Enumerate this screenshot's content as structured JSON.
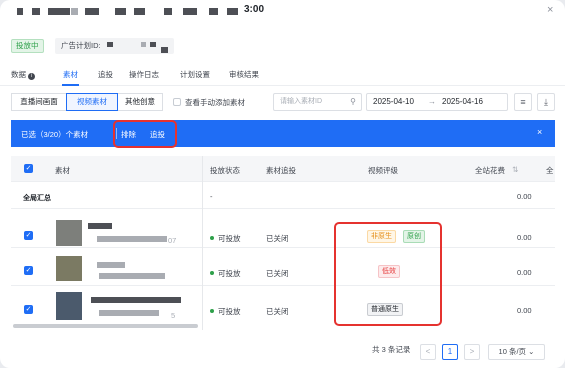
{
  "header": {
    "title": "3:00",
    "close_glyph": "×"
  },
  "status_badge": "投放中",
  "plan_label": "广告计划ID:",
  "tabs": [
    {
      "label": "数据"
    },
    {
      "label": "素材"
    },
    {
      "label": "追投"
    },
    {
      "label": "操作日志"
    },
    {
      "label": "计划设置"
    },
    {
      "label": "审核结果"
    }
  ],
  "toolbar": {
    "view_buttons": [
      "直播间画面",
      "视频素材",
      "其他创意"
    ],
    "manual_checkbox_label": "查看手动添加素材",
    "search_placeholder": "请输入素材ID",
    "date_start": "2025-04-10",
    "date_sep": "→",
    "date_end": "2025-04-16",
    "search_icon": "⚲",
    "settings_icon": "≡",
    "download_icon": "⤓"
  },
  "selection_bar": {
    "selected_text": "已选（3/20）个素材",
    "exclude_label": "排除",
    "boost_label": "追投",
    "close_glyph": "×"
  },
  "table": {
    "headers": {
      "material": "素材",
      "status": "投放状态",
      "boost": "素材追投",
      "rating": "视频评级",
      "spend": "全站花费",
      "next": "全"
    },
    "summary": {
      "label": "全局汇总",
      "status": "-",
      "spend": "0.00"
    },
    "rows": [
      {
        "id_suffix": "07",
        "status": "可投放",
        "boost": "已关闭",
        "spend": "0.00",
        "tags": [
          {
            "text": "非原生"
          },
          {
            "text": "原创"
          }
        ]
      },
      {
        "id_suffix": "",
        "status": "可投放",
        "boost": "已关闭",
        "spend": "0.00",
        "tags": [
          {
            "text": "低效"
          }
        ]
      },
      {
        "id_suffix": "5",
        "status": "可投放",
        "boost": "已关闭",
        "spend": "0.00",
        "tags": [
          {
            "text": "普通原生"
          }
        ]
      }
    ]
  },
  "pagination": {
    "total_text": "共 3 条记录",
    "prev": "<",
    "current_page": "1",
    "next": ">",
    "page_size": "10 条/页"
  },
  "colors": {
    "accent": "#1f6df5",
    "highlight_box": "#e5322f",
    "success": "#2ea04a"
  }
}
